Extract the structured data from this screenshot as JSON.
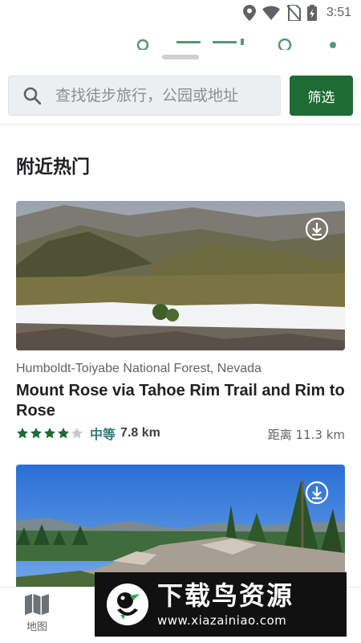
{
  "status_bar": {
    "time": "3:51",
    "icons": [
      "location-icon",
      "wifi-icon",
      "no-sim-icon",
      "battery-charging-icon"
    ]
  },
  "colors": {
    "brand_green": "#1e6b33",
    "difficulty_teal": "#2e7d7a",
    "star_filled": "#1e6b33",
    "star_empty": "#c8c8c8"
  },
  "search": {
    "placeholder": "查找徒步旅行，公园或地址",
    "icon": "search-icon"
  },
  "filter_button": {
    "label": "筛选"
  },
  "section": {
    "title": "附近热门"
  },
  "trails": [
    {
      "location": "Humboldt-Toiyabe National Forest, Nevada",
      "name": "Mount Rose via Tahoe Rim Trail and Rim to Rose",
      "rating": 4,
      "max_rating": 5,
      "difficulty": "中等",
      "length": "7.8 km",
      "distance": "距离 11.3 km",
      "icon": "download-icon"
    },
    {
      "location": "",
      "name": "",
      "rating": null,
      "difficulty": "",
      "length": "",
      "distance": "",
      "icon": "download-icon"
    }
  ],
  "bottom_nav": {
    "items": [
      {
        "label": "地图",
        "icon": "map-icon"
      }
    ]
  },
  "watermark": {
    "title": "下载鸟资源",
    "url": "www.xiazainiao.com"
  }
}
